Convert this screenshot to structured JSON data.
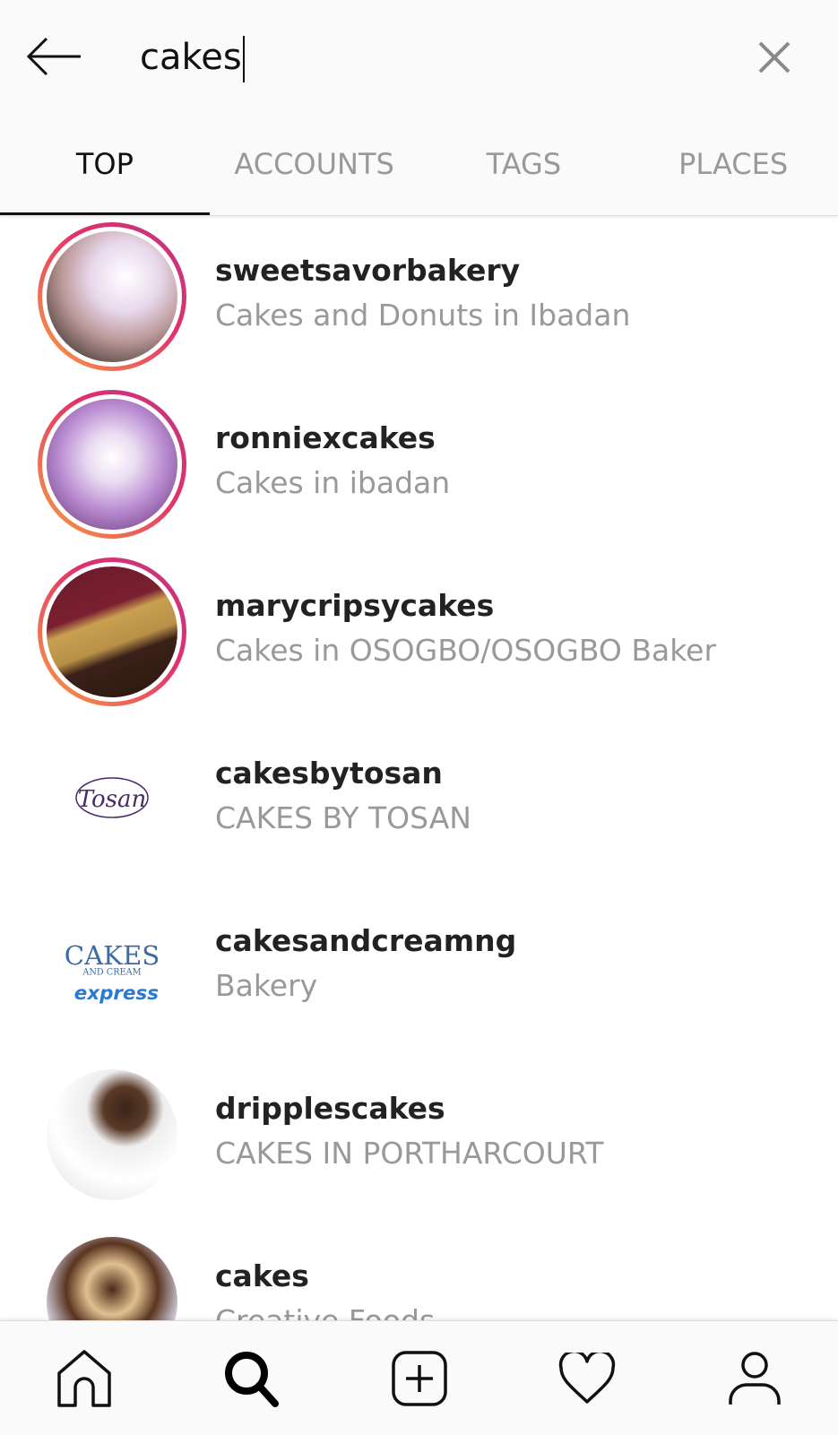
{
  "search": {
    "query": "cakes"
  },
  "tabs": [
    {
      "label": "TOP",
      "active": true
    },
    {
      "label": "ACCOUNTS",
      "active": false
    },
    {
      "label": "TAGS",
      "active": false
    },
    {
      "label": "PLACES",
      "active": false
    }
  ],
  "results": [
    {
      "username": "sweetsavorbakery",
      "subtitle": "Cakes and Donuts in Ibadan",
      "story_ring": true
    },
    {
      "username": "ronniexcakes",
      "subtitle": "Cakes in ibadan",
      "story_ring": true
    },
    {
      "username": "marycripsycakes",
      "subtitle": "Cakes in OSOGBO/OSOGBO Baker",
      "story_ring": true
    },
    {
      "username": "cakesbytosan",
      "subtitle": "CAKES BY TOSAN",
      "story_ring": false
    },
    {
      "username": "cakesandcreamng",
      "subtitle": "Bakery",
      "story_ring": false
    },
    {
      "username": "dripplescakes",
      "subtitle": "CAKES IN PORTHARCOURT",
      "story_ring": false
    },
    {
      "username": "cakes",
      "subtitle": "Creative Foods",
      "story_ring": false
    }
  ],
  "bottom_nav": [
    "home-icon",
    "search-icon",
    "add-post-icon",
    "heart-icon",
    "profile-icon"
  ],
  "colors": {
    "ring_start": "#f9a03f",
    "ring_end": "#c13584",
    "muted_text": "#999999"
  }
}
